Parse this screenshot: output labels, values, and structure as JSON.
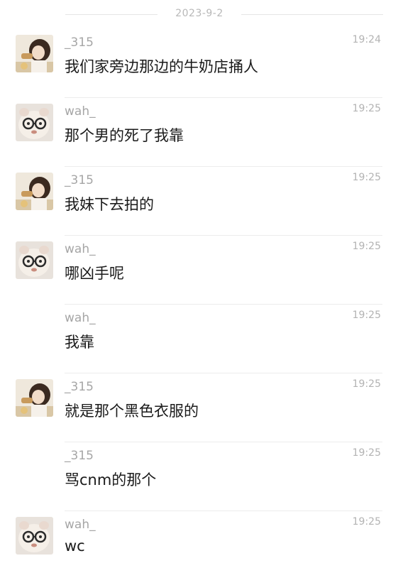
{
  "date_header": "2023-9-2",
  "messages": [
    {
      "sender": "_315",
      "time": "19:24",
      "text": "我们家旁边那边的牛奶店捅人",
      "avatar": "girl-avatar",
      "show_avatar": true
    },
    {
      "sender": "wah_",
      "time": "19:25",
      "text": "那个男的死了我靠",
      "avatar": "plush-glasses-avatar",
      "show_avatar": true
    },
    {
      "sender": "_315",
      "time": "19:25",
      "text": "我妹下去拍的",
      "avatar": "girl-avatar",
      "show_avatar": true
    },
    {
      "sender": "wah_",
      "time": "19:25",
      "text": "哪凶手呢",
      "avatar": "plush-glasses-avatar",
      "show_avatar": true
    },
    {
      "sender": "wah_",
      "time": "19:25",
      "text": "我靠",
      "avatar": "plush-glasses-avatar",
      "show_avatar": false
    },
    {
      "sender": "_315",
      "time": "19:25",
      "text": "就是那个黑色衣服的",
      "avatar": "girl-avatar",
      "show_avatar": true
    },
    {
      "sender": "_315",
      "time": "19:25",
      "text": "骂cnm的那个",
      "avatar": "girl-avatar",
      "show_avatar": false
    },
    {
      "sender": "wah_",
      "time": "19:25",
      "text": "wc",
      "avatar": "plush-glasses-avatar",
      "show_avatar": true
    }
  ]
}
